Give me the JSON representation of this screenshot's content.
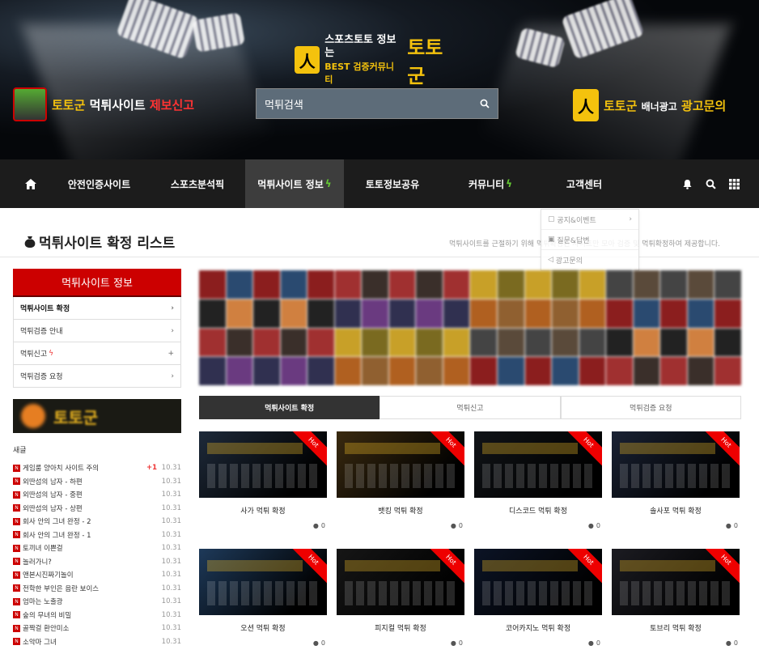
{
  "header": {
    "logo": {
      "line1": "스포츠토토 정보는",
      "line2": "BEST 검증커뮤니티",
      "brand": "토토군"
    },
    "report": {
      "prefix": "토토군",
      "middle": "먹튀사이트",
      "suffix": "제보신고"
    },
    "advert": {
      "prefix": "토토군",
      "middle": "배너광고",
      "suffix": "광고문의"
    },
    "search": {
      "placeholder": "먹튀검색"
    }
  },
  "nav": {
    "items": [
      "안전인증사이트",
      "스포츠분석픽",
      "먹튀사이트 정보",
      "토토정보공유",
      "커뮤니티",
      "고객센터"
    ],
    "active_index": 2
  },
  "dropdown": {
    "items": [
      "공지&이벤트",
      "질문&답변",
      "광고문의"
    ]
  },
  "page": {
    "title": "먹튀사이트 확정 리스트",
    "description": "먹튀사이트를 근절하기 위해 먹튀확정된 사이트만 모아 검증 및 먹튀확정하여 제공합니다."
  },
  "sidebar": {
    "heading": "먹튀사이트 정보",
    "items": [
      "먹튀사이트 확정",
      "먹튀검증 안내",
      "먹튀신고",
      "먹튀검증 요청"
    ],
    "banner_text": "토토군"
  },
  "latest": {
    "heading": "새글",
    "rows": [
      {
        "title": "게임룸 양아치 사이트 주의",
        "plus": "+1",
        "date": "10.31"
      },
      {
        "title": "외딴섬의 남자 - 하편",
        "plus": "",
        "date": "10.31"
      },
      {
        "title": "외딴섬의 남자 - 중편",
        "plus": "",
        "date": "10.31"
      },
      {
        "title": "외딴섬의 남자 - 상편",
        "plus": "",
        "date": "10.31"
      },
      {
        "title": "회사 안의 그녀 완정 - 2",
        "plus": "",
        "date": "10.31"
      },
      {
        "title": "회사 안의 그녀 완정 - 1",
        "plus": "",
        "date": "10.31"
      },
      {
        "title": "토끼녀 이쁜걸",
        "plus": "",
        "date": "10.31"
      },
      {
        "title": "놀러가니?",
        "plus": "",
        "date": "10.31"
      },
      {
        "title": "앤본시진짜기놀이",
        "plus": "",
        "date": "10.31"
      },
      {
        "title": "전학한 부인은 음란 보이스",
        "plus": "",
        "date": "10.31"
      },
      {
        "title": "엄마는 노출광",
        "plus": "",
        "date": "10.31"
      },
      {
        "title": "숲의 무녀의 비밀",
        "plus": "",
        "date": "10.31"
      },
      {
        "title": "골짝걸 환안미소",
        "plus": "",
        "date": "10.31"
      },
      {
        "title": "소악마 그녀",
        "plus": "",
        "date": "10.31"
      }
    ]
  },
  "tabs": [
    "먹튀사이트 확정",
    "먹튀신고",
    "먹튀검증 요청"
  ],
  "cards": [
    {
      "name": "사가 먹튀 확정",
      "comments": "0",
      "badge": "Hot",
      "bg": "#1e2a3a"
    },
    {
      "name": "뱃킹 먹튀 확정",
      "comments": "0",
      "badge": "Hot",
      "bg": "#3a2a10"
    },
    {
      "name": "디스코드 먹튀 확정",
      "comments": "0",
      "badge": "Hot",
      "bg": "#111418"
    },
    {
      "name": "솔사포 먹튀 확정",
      "comments": "0",
      "badge": "Hot",
      "bg": "#1a2234"
    },
    {
      "name": "오션 먹튀 확정",
      "comments": "0",
      "badge": "Hot",
      "bg": "#1e3a5a"
    },
    {
      "name": "피지컬 먹튀 확정",
      "comments": "0",
      "badge": "Hot",
      "bg": "#161616"
    },
    {
      "name": "코어카지노 먹튀 확정",
      "comments": "0",
      "badge": "Hot",
      "bg": "#0c1426"
    },
    {
      "name": "토브리 먹튀 확정",
      "comments": "0",
      "badge": "Hot",
      "bg": "#1c1c22"
    }
  ],
  "colors": {
    "accent": "#cc0000",
    "nav_bg": "#1c1c1c",
    "brand_yellow": "#f4c20d"
  }
}
